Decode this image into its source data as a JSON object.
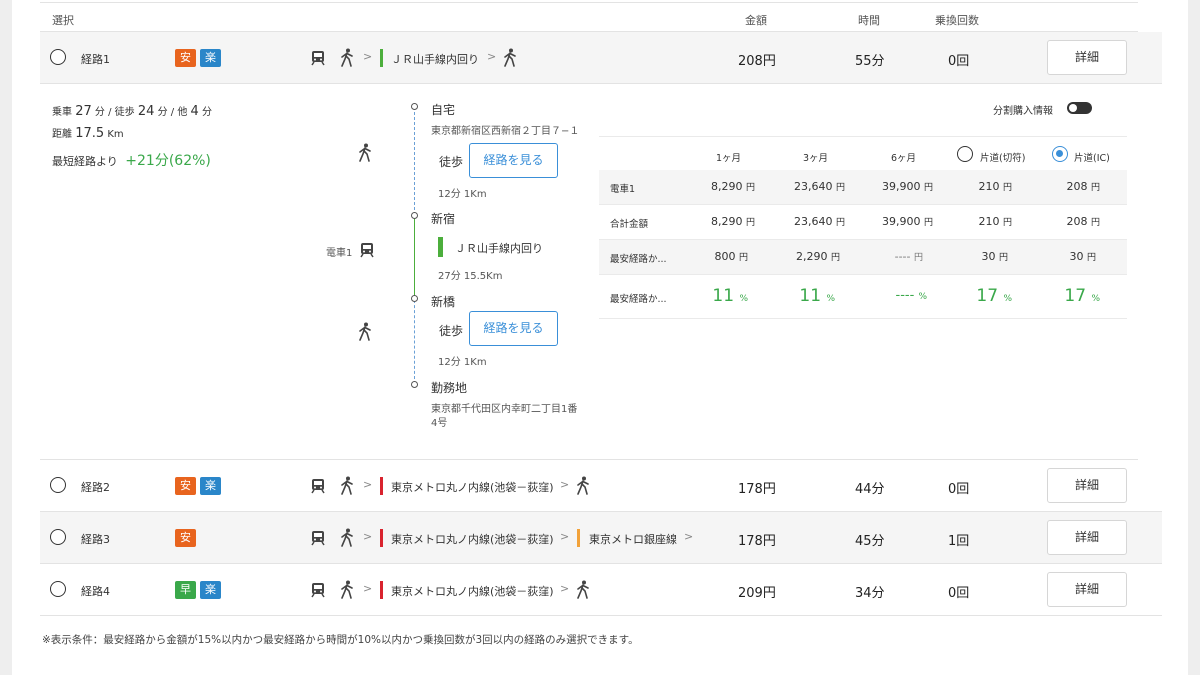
{
  "header": {
    "select": "選択",
    "fare": "金額",
    "time": "時間",
    "transfers": "乗換回数"
  },
  "routes": [
    {
      "name": "経路1",
      "badges": [
        {
          "label": "安",
          "color": "#e8641e"
        },
        {
          "label": "楽",
          "color": "#2a86c9"
        }
      ],
      "lines": [
        {
          "name": "ＪＲ山手線内回り",
          "color": "#4cae3c"
        }
      ],
      "fare": "208円",
      "time": "55分",
      "transfers": "0回",
      "detail": "詳細"
    },
    {
      "name": "経路2",
      "badges": [
        {
          "label": "安",
          "color": "#e8641e"
        },
        {
          "label": "楽",
          "color": "#2a86c9"
        }
      ],
      "lines": [
        {
          "name": "東京メトロ丸ノ内線(池袋－荻窪)",
          "color": "#d9232e"
        }
      ],
      "fare": "178円",
      "time": "44分",
      "transfers": "0回",
      "detail": "詳細"
    },
    {
      "name": "経路3",
      "badges": [
        {
          "label": "安",
          "color": "#e8641e"
        }
      ],
      "lines": [
        {
          "name": "東京メトロ丸ノ内線(池袋－荻窪)",
          "color": "#d9232e"
        },
        {
          "name": "東京メトロ銀座線",
          "color": "#f2a23a"
        }
      ],
      "fare": "178円",
      "time": "45分",
      "transfers": "1回",
      "detail": "詳細"
    },
    {
      "name": "経路4",
      "badges": [
        {
          "label": "早",
          "color": "#3aa84a"
        },
        {
          "label": "楽",
          "color": "#2a86c9"
        }
      ],
      "lines": [
        {
          "name": "東京メトロ丸ノ内線(池袋－荻窪)",
          "color": "#d9232e"
        }
      ],
      "fare": "209円",
      "time": "34分",
      "transfers": "0回",
      "detail": "詳細"
    }
  ],
  "summary": {
    "train_label": "乗車",
    "train_val": "27",
    "minute_unit": "分",
    "walk_label": "徒歩",
    "walk_val": "24",
    "other_label": "他",
    "other_val": "4",
    "sep": "/",
    "distance_label": "距離",
    "distance_val": "17.5",
    "distance_unit": "Km",
    "shortest_label": "最短経路より",
    "shortest_diff": "+21分(62%)"
  },
  "timeline": {
    "stations": [
      {
        "name": "自宅",
        "address": "東京都新宿区西新宿２丁目７−１"
      },
      {
        "name": "新宿",
        "address": ""
      },
      {
        "name": "新橋",
        "address": ""
      },
      {
        "name": "勤務地",
        "address_line1": "東京都千代田区内幸町二丁目1番",
        "address_line2": "4号"
      }
    ],
    "walk1": {
      "label": "徒歩",
      "button": "経路を見る",
      "info": "12分 1Km"
    },
    "train1": {
      "side_label": "電車1",
      "line": "ＪＲ山手線内回り",
      "info": "27分 15.5Km",
      "color": "#4cae3c"
    },
    "walk2": {
      "label": "徒歩",
      "button": "経路を見る",
      "info": "12分 1Km"
    }
  },
  "fare_table": {
    "installment_label": "分割購入情報",
    "columns": [
      "1ヶ月",
      "3ヶ月",
      "6ヶ月",
      "片道(切符)",
      "片道(IC)"
    ],
    "rows": [
      {
        "label": "電車1",
        "values": [
          "8,290",
          "23,640",
          "39,900",
          "210",
          "208"
        ],
        "unit": "円"
      },
      {
        "label": "合計金額",
        "values": [
          "8,290",
          "23,640",
          "39,900",
          "210",
          "208"
        ],
        "unit": "円"
      },
      {
        "label": "最安経路か...",
        "values": [
          "800",
          "2,290",
          "----",
          "30",
          "30"
        ],
        "unit": "円"
      },
      {
        "label": "最安経路か...",
        "values": [
          "11",
          "11",
          "----",
          "17",
          "17"
        ],
        "unit": "%"
      }
    ]
  },
  "footer_note": "※表示条件：最安経路から金額が15%以内かつ最安経路から時間が10%以内かつ乗換回数が3回以内の経路のみ選択できます。"
}
